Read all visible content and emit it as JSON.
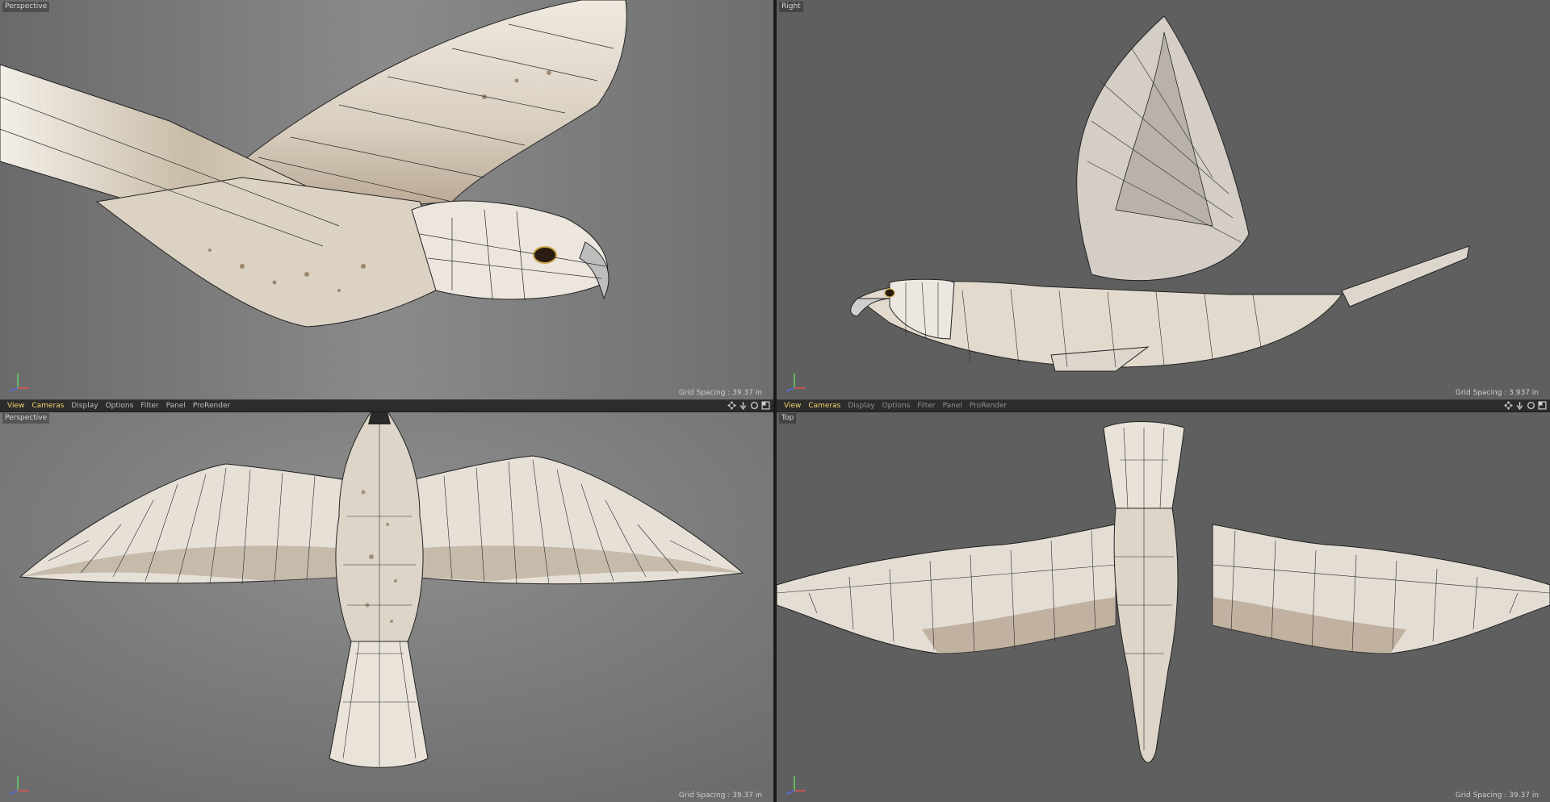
{
  "viewports": {
    "tl": {
      "label": "Perspective",
      "grid": "Grid Spacing : 39.37 in"
    },
    "tr": {
      "label": "Right",
      "grid": "Grid Spacing : 3.937 in"
    },
    "bl": {
      "label": "Perspective",
      "grid": "Grid Spacing : 39.37 in"
    },
    "br": {
      "label": "Top",
      "grid": "Grid Spacing : 39.37 in"
    }
  },
  "menubar_left": {
    "items": [
      "View",
      "Cameras",
      "Display",
      "Options",
      "Filter",
      "Panel",
      "ProRender"
    ]
  },
  "menubar_right": {
    "items": [
      "View",
      "Cameras",
      "Display",
      "Options",
      "Filter",
      "Panel",
      "ProRender"
    ]
  },
  "icons": [
    "move-icon",
    "zoom-icon",
    "rotate-icon",
    "maximize-icon"
  ],
  "colors": {
    "viewport_bg": "#6b6b6b",
    "menubar_bg": "#2c2c2c",
    "active_menu": "#f2d36a",
    "feather": "#e8e1d6",
    "wire": "#1c1c1c"
  }
}
